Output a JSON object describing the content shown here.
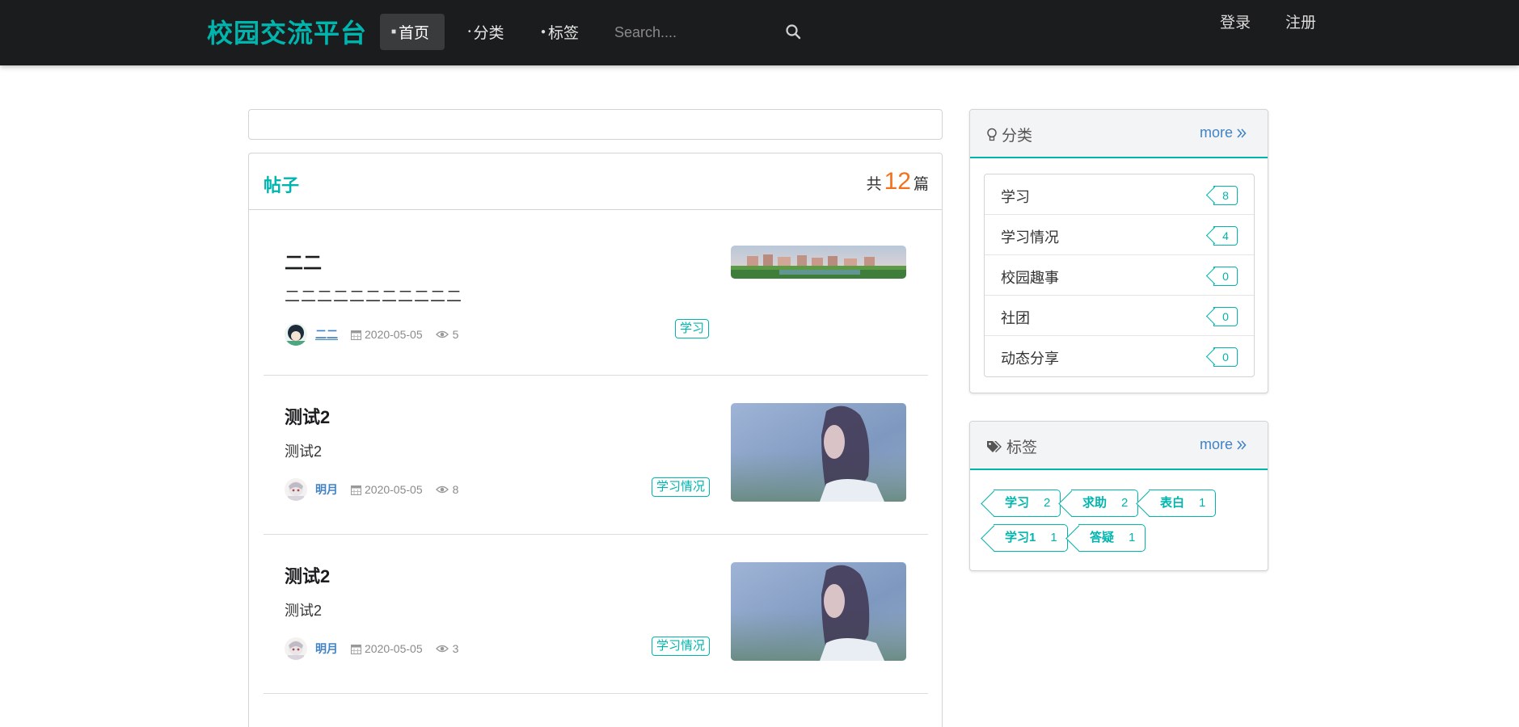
{
  "navbar": {
    "brand": "校园交流平台",
    "home": "首页",
    "category": "分类",
    "tags": "标签",
    "search_placeholder": "Search....",
    "login": "登录",
    "register": "注册"
  },
  "posts": {
    "title": "帖子",
    "count_prefix": "共",
    "count": "12",
    "count_suffix": "篇",
    "items": [
      {
        "title": "二二",
        "desc": "二二二二二二二二二二二",
        "author": "二二",
        "date": "2020-05-05",
        "views": "5",
        "tag": "学习"
      },
      {
        "title": "测试2",
        "desc": "测试2",
        "author": "明月",
        "date": "2020-05-05",
        "views": "8",
        "tag": "学习情况"
      },
      {
        "title": "测试2",
        "desc": "测试2",
        "author": "明月",
        "date": "2020-05-05",
        "views": "3",
        "tag": "学习情况"
      }
    ]
  },
  "sidebar": {
    "categories": {
      "title": "分类",
      "more": "more",
      "items": [
        {
          "name": "学习",
          "count": "8"
        },
        {
          "name": "学习情况",
          "count": "4"
        },
        {
          "name": "校园趣事",
          "count": "0"
        },
        {
          "name": "社团",
          "count": "0"
        },
        {
          "name": "动态分享",
          "count": "0"
        }
      ]
    },
    "tags": {
      "title": "标签",
      "more": "more",
      "items": [
        {
          "name": "学习",
          "count": "2"
        },
        {
          "name": "求助",
          "count": "2"
        },
        {
          "name": "表白",
          "count": "1"
        },
        {
          "name": "学习1",
          "count": "1"
        },
        {
          "name": "答疑",
          "count": "1"
        }
      ]
    }
  },
  "colors": {
    "accent": "#00b5ad",
    "navbar": "#1b1c1d",
    "link": "#4183c4",
    "count": "#f2711c"
  }
}
